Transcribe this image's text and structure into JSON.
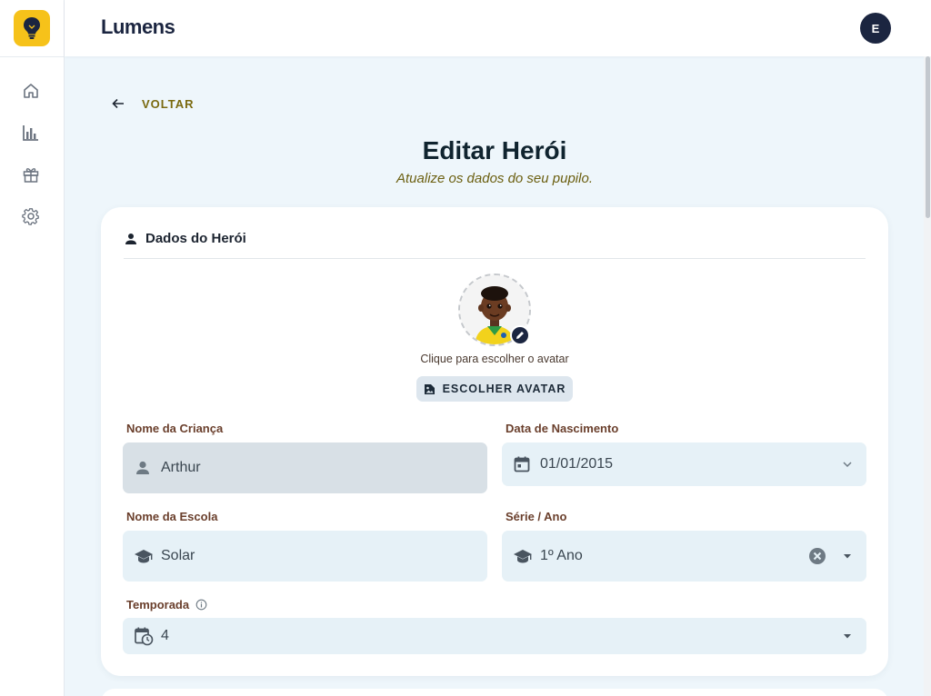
{
  "app": {
    "brand": "Lumens",
    "user_initial": "E"
  },
  "nav": {
    "back_label": "VOLTAR"
  },
  "page": {
    "title": "Editar Herói",
    "subtitle": "Atualize os dados do seu pupilo."
  },
  "section": {
    "title": "Dados do Herói"
  },
  "avatar": {
    "hint": "Clique para escolher o avatar",
    "button_label": "ESCOLHER AVATAR"
  },
  "form": {
    "child_name": {
      "label": "Nome da Criança",
      "value": "Arthur"
    },
    "birth_date": {
      "label": "Data de Nascimento",
      "value": "01/01/2015"
    },
    "school": {
      "label": "Nome da Escola",
      "value": "Solar"
    },
    "grade": {
      "label": "Série / Ano",
      "value": "1º Ano"
    },
    "season": {
      "label": "Temporada",
      "value": "4"
    }
  },
  "colors": {
    "accent": "#f6c21a",
    "navy": "#1b2540",
    "field_bg": "#e6f1f7",
    "page_bg": "#eef6fb"
  },
  "icons": [
    "lightbulb-icon",
    "home-icon",
    "chart-icon",
    "gift-icon",
    "gear-icon",
    "arrow-left-icon",
    "person-icon",
    "pencil-icon",
    "image-icon",
    "calendar-icon",
    "school-icon",
    "clear-icon",
    "caret-down-icon",
    "chevron-down-icon",
    "info-icon",
    "calendar-clock-icon"
  ]
}
